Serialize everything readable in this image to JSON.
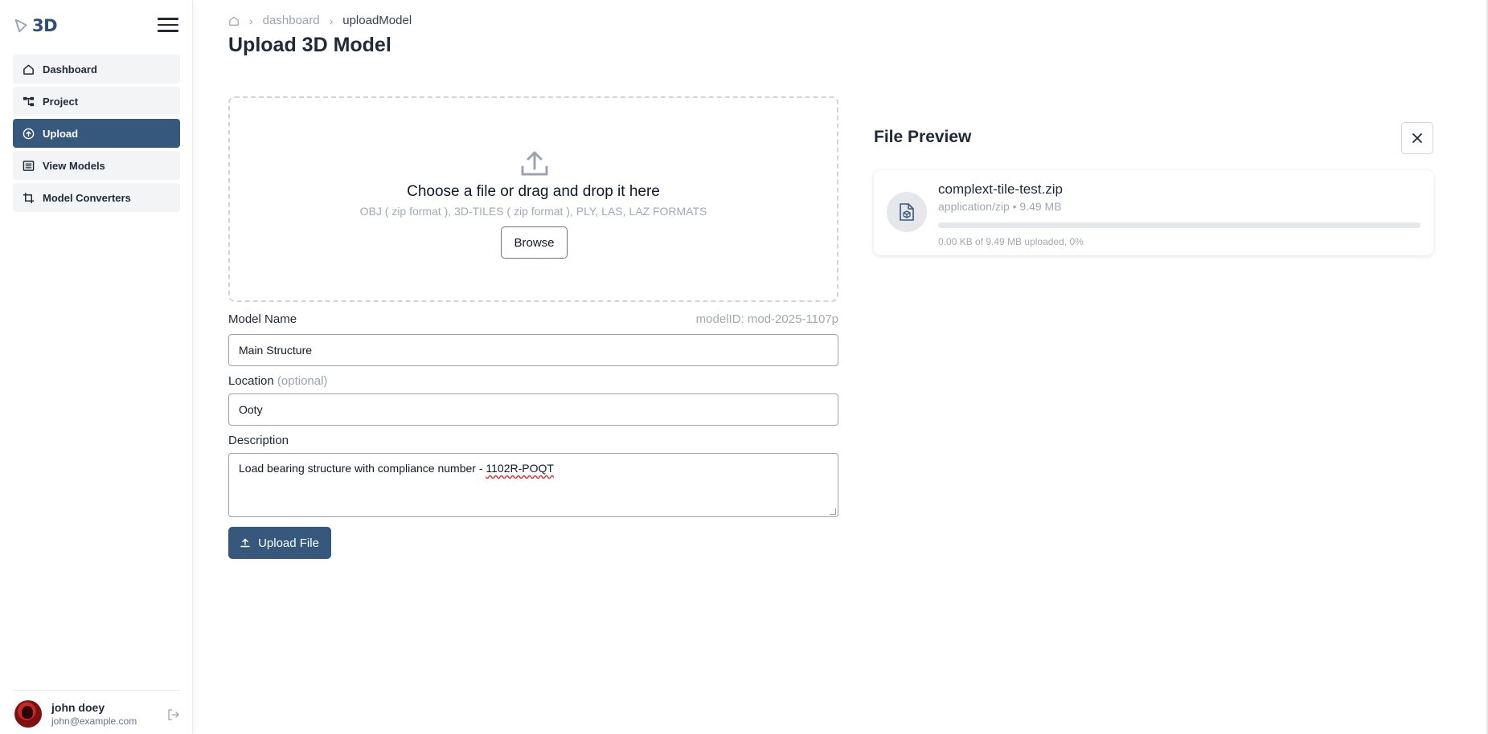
{
  "app": {
    "logo_text": "3D"
  },
  "sidebar": {
    "items": [
      {
        "label": "Dashboard",
        "icon": "home-icon",
        "active": false
      },
      {
        "label": "Project",
        "icon": "project-tree-icon",
        "active": false
      },
      {
        "label": "Upload",
        "icon": "cloud-upload-icon",
        "active": true
      },
      {
        "label": "View Models",
        "icon": "list-icon",
        "active": false
      },
      {
        "label": "Model Converters",
        "icon": "crop-icon",
        "active": false
      }
    ]
  },
  "user": {
    "name": "john doey",
    "email": "john@example.com"
  },
  "breadcrumb": {
    "items": [
      "dashboard",
      "uploadModel"
    ]
  },
  "page": {
    "title": "Upload 3D Model"
  },
  "dropzone": {
    "title": "Choose a file or drag and drop it here",
    "formats": "OBJ ( zip format ), 3D-TILES ( zip format ), PLY, LAS, LAZ FORMATS",
    "browse_label": "Browse"
  },
  "form": {
    "model_name_label": "Model Name",
    "model_id": "modelID: mod-2025-1107p",
    "model_name_value": "Main Structure",
    "location_label": "Location",
    "location_optional": "(optional)",
    "location_value": "Ooty",
    "description_label": "Description",
    "description_prefix": "Load bearing structure with compliance number - ",
    "description_code": "1102R-POQT",
    "upload_label": "Upload File"
  },
  "preview": {
    "title": "File Preview",
    "file_name": "complext-tile-test.zip",
    "file_meta": "application/zip • 9.49 MB",
    "progress_text": "0.00 KB of 9.49 MB uploaded, 0%",
    "progress": 0
  },
  "colors": {
    "primary": "#36587d",
    "muted_text": "#a3a8b1"
  }
}
